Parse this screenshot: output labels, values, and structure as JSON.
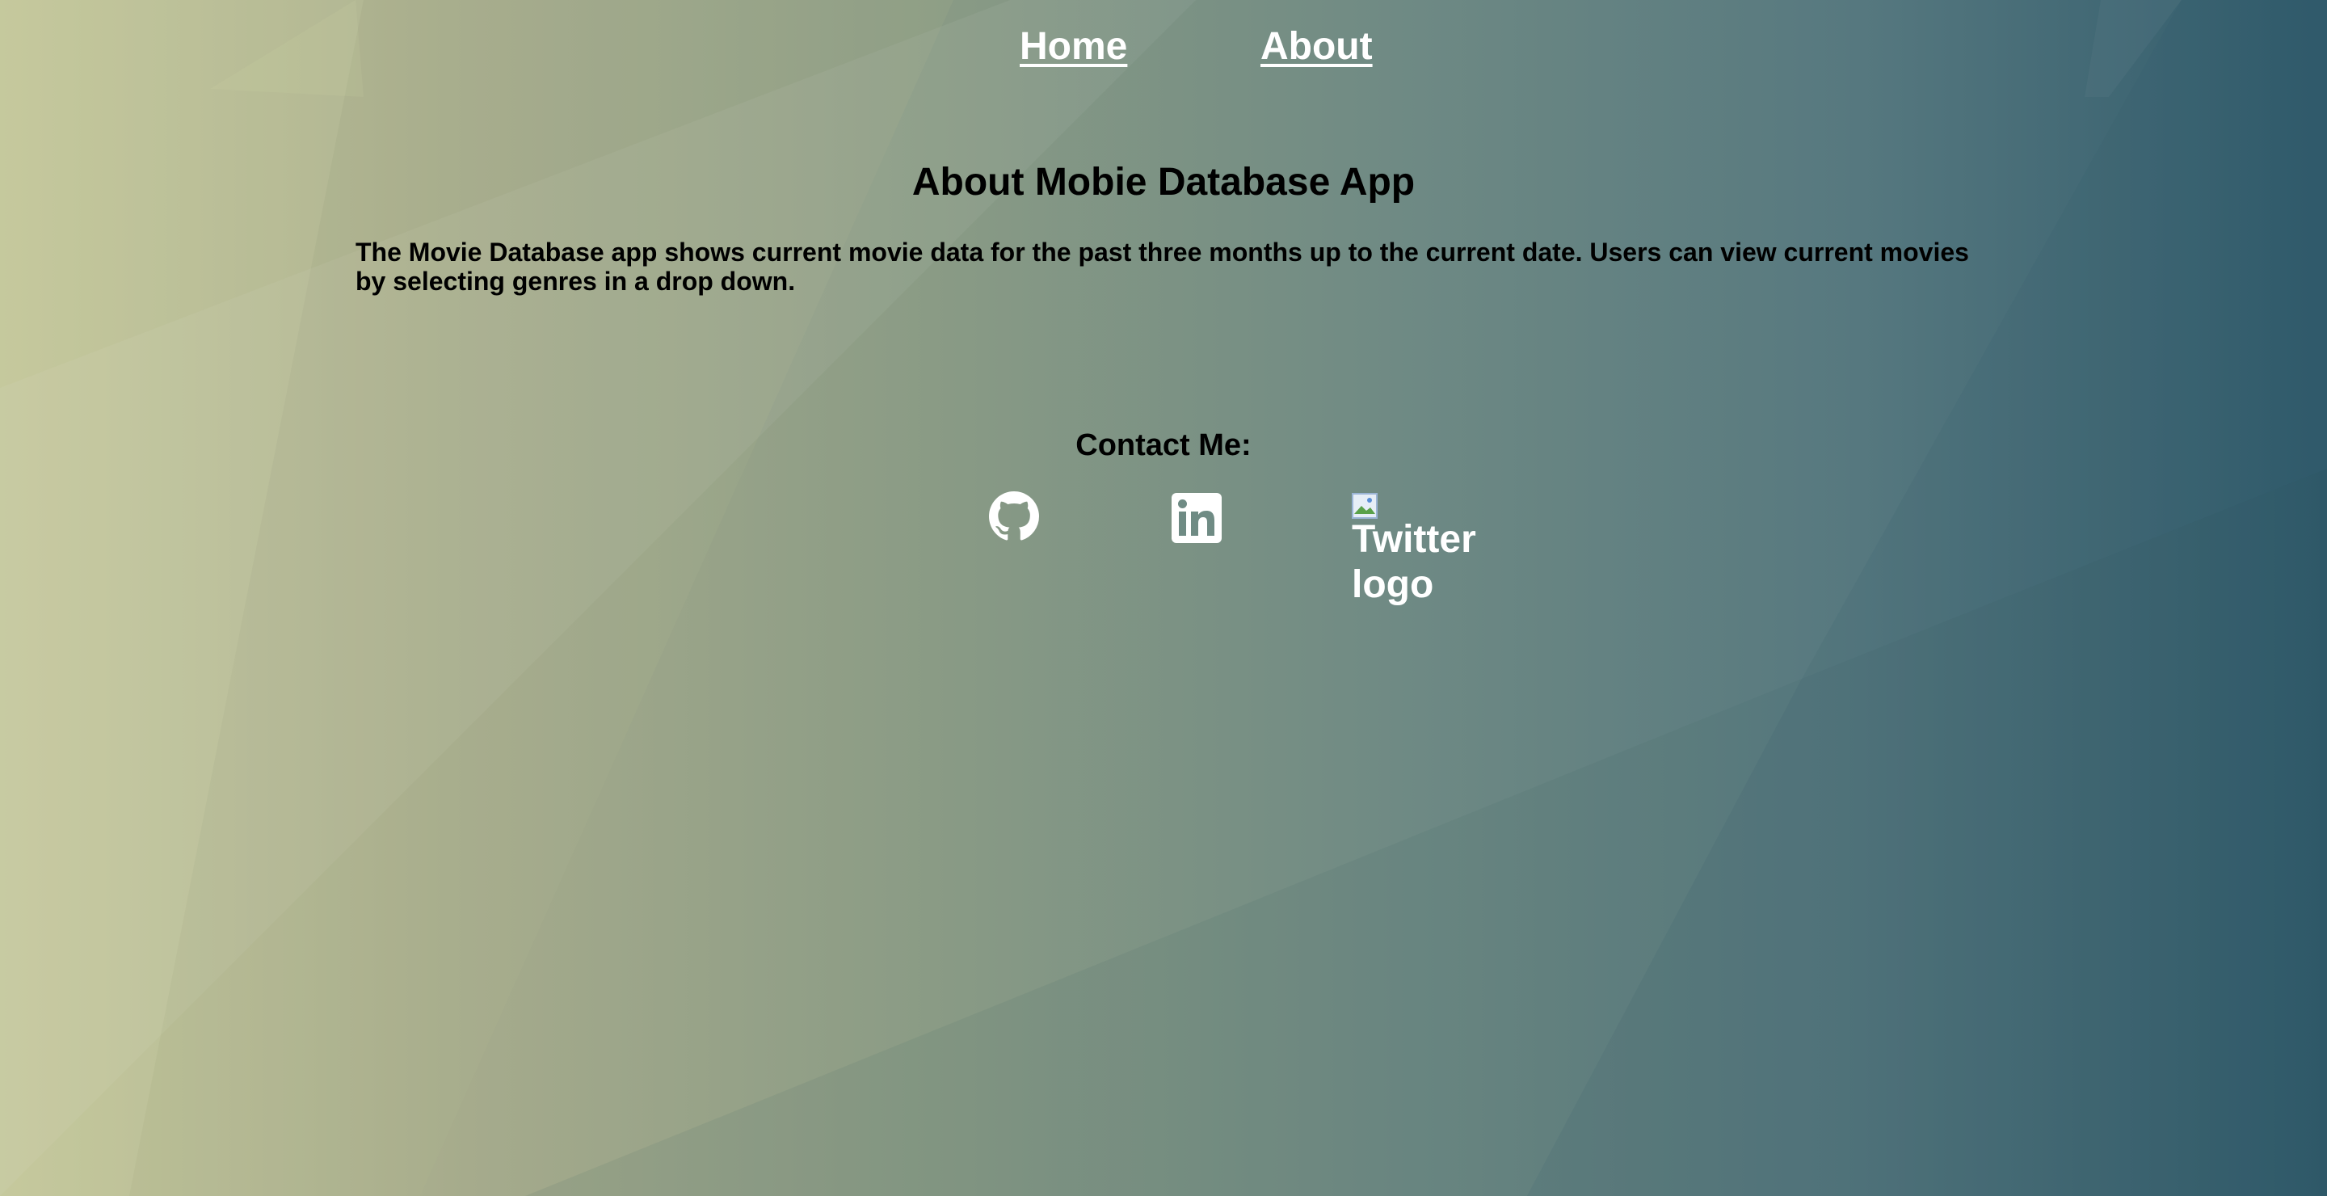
{
  "nav": {
    "home_label": "Home",
    "about_label": "About"
  },
  "about": {
    "title": "About Mobie Database App",
    "description": "The Movie Database app shows current movie data for the past three months up to the current date. Users can view current movies by selecting genres in a drop down."
  },
  "contact": {
    "heading": "Contact Me:",
    "icons": [
      {
        "name": "github-icon"
      },
      {
        "name": "linkedin-icon"
      },
      {
        "name": "twitter-icon",
        "alt": "Twitter logo"
      }
    ]
  },
  "colors": {
    "link": "#ffffff",
    "text": "#000000",
    "gradient_left": "#c3c69a",
    "gradient_right": "#2f5a6b"
  }
}
